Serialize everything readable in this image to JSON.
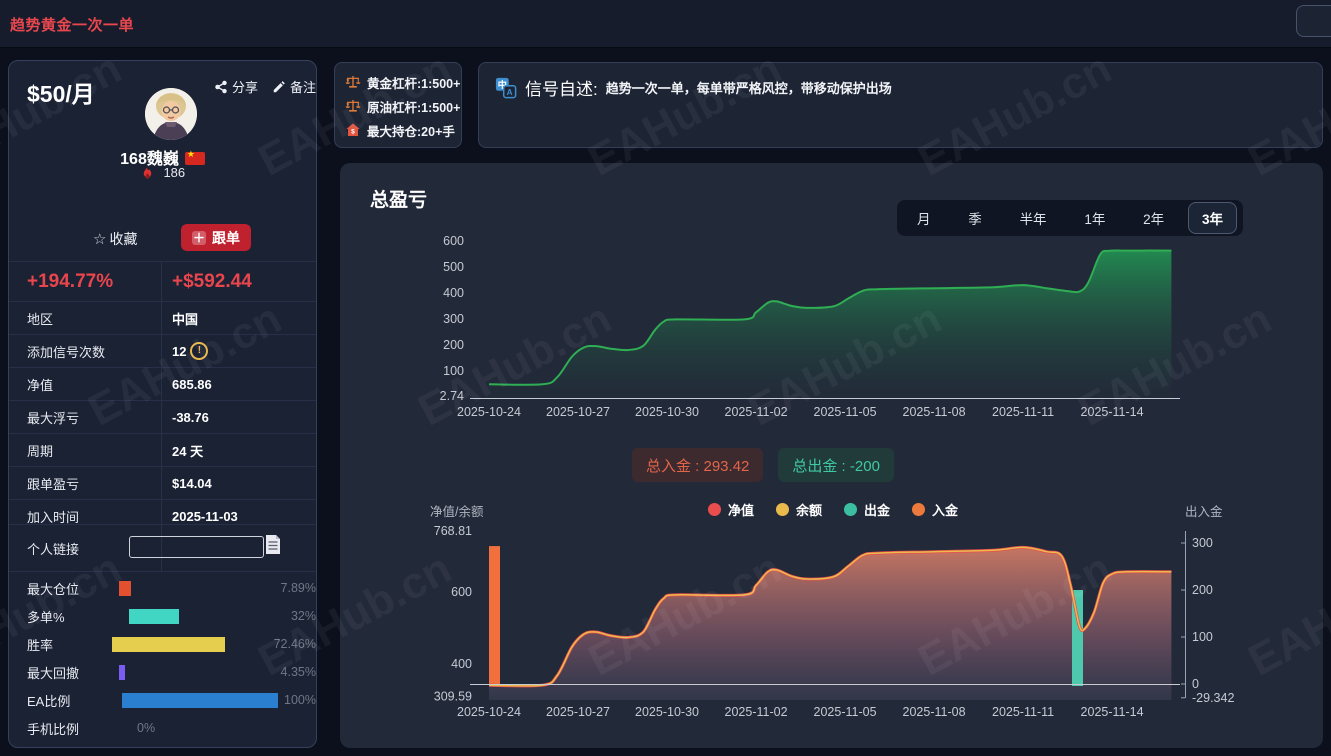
{
  "topbar": {
    "title": "趋势黄金一次一单"
  },
  "watermark": "EAHub.cn",
  "profile": {
    "price": "$50/月",
    "share_label": "分享",
    "note_label": "备注",
    "name": "168魏巍",
    "heat_count": "186",
    "favorite_label": "收藏",
    "follow_label": "跟单",
    "return_pct": "+194.77%",
    "profit_usd": "+$592.44",
    "stats": [
      {
        "label": "地区",
        "value": "中国"
      },
      {
        "label": "添加信号次数",
        "value": "12",
        "warn": "!"
      },
      {
        "label": "净值",
        "value": "685.86"
      },
      {
        "label": "最大浮亏",
        "value": "-38.76"
      },
      {
        "label": "周期",
        "value": "24 天"
      },
      {
        "label": "跟单盈亏",
        "value": "$14.04"
      },
      {
        "label": "加入时间",
        "value": "2025-11-03"
      }
    ],
    "link_label": "个人链接",
    "link_value": "",
    "bars": [
      {
        "label": "最大仓位",
        "value": "7.89%",
        "pct": 7.89,
        "color": "#e3502f"
      },
      {
        "label": "多单%",
        "value": "32%",
        "pct": 32,
        "color": "#40d6c3"
      },
      {
        "label": "胜率",
        "value": "72.46%",
        "pct": 72.46,
        "color": "#e5ce4e"
      },
      {
        "label": "最大回撤",
        "value": "4.35%",
        "pct": 4.35,
        "color": "#7a5cf0"
      },
      {
        "label": "EA比例",
        "value": "100%",
        "pct": 100,
        "color": "#2b7fd0"
      },
      {
        "label": "手机比例",
        "value": "0%",
        "pct": 0,
        "color": "#2b7fd0"
      }
    ]
  },
  "leverage_box": {
    "items": [
      {
        "icon": "scales-icon",
        "text": "黄金杠杆:1:500+"
      },
      {
        "icon": "scales-icon",
        "text": "原油杠杆:1:500+"
      },
      {
        "icon": "house-dollar-icon",
        "text": "最大持仓:20+手"
      }
    ]
  },
  "signal_desc": {
    "title": "信号自述:",
    "text": "趋势一次一单，每单带严格风控，带移动保护出场"
  },
  "panel": {
    "title": "总盈亏",
    "tabs": [
      "月",
      "季",
      "半年",
      "1年",
      "2年",
      "3年"
    ],
    "active_tab_index": 5,
    "badge_total_in": "总入金 : 293.42",
    "badge_total_out": "总出金 : -200",
    "legend": [
      {
        "label": "净值",
        "color": "#ea4d4d"
      },
      {
        "label": "余额",
        "color": "#e9bb4d"
      },
      {
        "label": "出金",
        "color": "#3bbfa0"
      },
      {
        "label": "入金",
        "color": "#ed7a3c"
      }
    ]
  },
  "chart_data": [
    {
      "type": "area",
      "title": "总盈亏",
      "x_is_days_from": "2025-10-24",
      "x_tick_days": [
        0,
        3,
        6,
        9,
        12,
        15,
        18,
        21
      ],
      "x_tick_labels": [
        "2025-10-24",
        "2025-10-27",
        "2025-10-30",
        "2025-11-02",
        "2025-11-05",
        "2025-11-08",
        "2025-11-11",
        "2025-11-14"
      ],
      "y_ticks": [
        600,
        500,
        400,
        300,
        200,
        100,
        2.74
      ],
      "ylim": [
        2.74,
        620
      ],
      "line_color": "#2fae54",
      "grid": false,
      "points": [
        [
          0,
          48
        ],
        [
          1.8,
          48
        ],
        [
          2.3,
          75
        ],
        [
          2.8,
          155
        ],
        [
          3.2,
          190
        ],
        [
          3.6,
          195
        ],
        [
          4.1,
          185
        ],
        [
          4.7,
          180
        ],
        [
          5.2,
          196
        ],
        [
          5.6,
          258
        ],
        [
          5.9,
          290
        ],
        [
          6.3,
          298
        ],
        [
          8.6,
          298
        ],
        [
          9.0,
          325
        ],
        [
          9.4,
          362
        ],
        [
          9.7,
          367
        ],
        [
          10.2,
          350
        ],
        [
          10.7,
          342
        ],
        [
          11.6,
          348
        ],
        [
          12.1,
          378
        ],
        [
          12.6,
          408
        ],
        [
          13.1,
          414
        ],
        [
          15.0,
          418
        ],
        [
          17.0,
          422
        ],
        [
          18.0,
          430
        ],
        [
          18.8,
          418
        ],
        [
          19.5,
          407
        ],
        [
          19.9,
          405
        ],
        [
          20.2,
          440
        ],
        [
          20.6,
          548
        ],
        [
          20.9,
          562
        ],
        [
          21.5,
          563
        ],
        [
          23.0,
          563
        ]
      ]
    },
    {
      "type": "mixed",
      "left_axis_title": "净值/余额",
      "right_axis_title": "出入金",
      "left_ticks": [
        768.81,
        600,
        400,
        309.59
      ],
      "right_ticks": [
        300,
        200,
        100,
        0,
        -29.342
      ],
      "left_ylim": [
        309.59,
        768.81
      ],
      "right_ylim": [
        -29.342,
        310
      ],
      "x_tick_days": [
        0,
        3,
        6,
        9,
        12,
        15,
        18,
        21
      ],
      "x_tick_labels": [
        "2025-10-24",
        "2025-10-27",
        "2025-10-30",
        "2025-11-02",
        "2025-11-05",
        "2025-11-08",
        "2025-11-11",
        "2025-11-14"
      ],
      "total_in": "293.42",
      "total_out": "-200",
      "equity_points": [
        [
          0,
          341
        ],
        [
          1.8,
          341
        ],
        [
          2.3,
          368
        ],
        [
          2.8,
          448
        ],
        [
          3.2,
          483
        ],
        [
          3.6,
          489
        ],
        [
          4.1,
          479
        ],
        [
          4.7,
          474
        ],
        [
          5.2,
          489
        ],
        [
          5.6,
          551
        ],
        [
          5.9,
          583
        ],
        [
          6.3,
          592
        ],
        [
          8.6,
          592
        ],
        [
          9.0,
          618
        ],
        [
          9.4,
          656
        ],
        [
          9.7,
          661
        ],
        [
          10.2,
          644
        ],
        [
          10.7,
          636
        ],
        [
          11.6,
          642
        ],
        [
          12.1,
          671
        ],
        [
          12.6,
          702
        ],
        [
          13.1,
          708
        ],
        [
          15.0,
          712
        ],
        [
          17.0,
          716
        ],
        [
          18.0,
          724
        ],
        [
          18.8,
          712
        ],
        [
          19.3,
          700
        ],
        [
          19.6,
          620
        ],
        [
          19.9,
          505
        ],
        [
          20.1,
          500
        ],
        [
          20.4,
          545
        ],
        [
          20.7,
          625
        ],
        [
          21.0,
          650
        ],
        [
          21.5,
          656
        ],
        [
          23.0,
          656
        ]
      ],
      "series": [
        {
          "name": "净值",
          "type": "line",
          "color": "#ea4d4d",
          "points_ref": "equity_points"
        },
        {
          "name": "余额",
          "type": "line",
          "color": "#e9bb4d",
          "points_ref": "equity_points"
        },
        {
          "name": "出金",
          "type": "bar",
          "color": "#4ec9ad",
          "points": [
            [
              19.65,
              -200
            ]
          ]
        },
        {
          "name": "入金",
          "type": "bar",
          "color": "#f2703d",
          "points": [
            [
              0,
              293.42
            ]
          ]
        }
      ]
    }
  ]
}
